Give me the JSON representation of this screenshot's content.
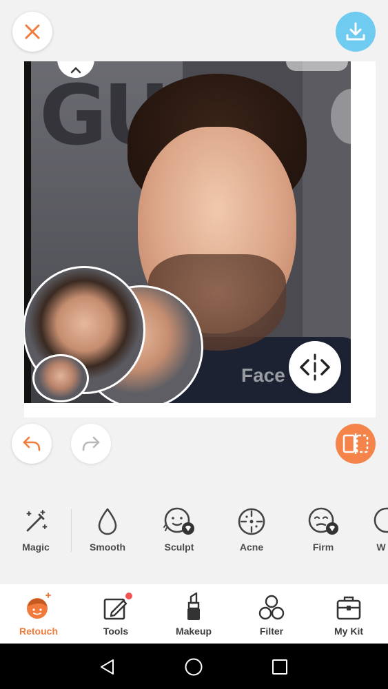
{
  "top_bar": {
    "close_icon": "close-icon",
    "download_icon": "download-icon"
  },
  "photo": {
    "watermark": "Face"
  },
  "history": {
    "undo_icon": "undo-icon",
    "redo_icon": "redo-icon",
    "compare_icon": "compare-icon"
  },
  "tools": [
    {
      "label": "Magic",
      "icon": "magic-wand-icon"
    },
    {
      "label": "Smooth",
      "icon": "drop-icon"
    },
    {
      "label": "Sculpt",
      "icon": "face-sculpt-icon",
      "premium": true
    },
    {
      "label": "Acne",
      "icon": "acne-icon"
    },
    {
      "label": "Firm",
      "icon": "face-firm-icon",
      "premium": true
    },
    {
      "label": "W",
      "icon": "partial-icon"
    }
  ],
  "bottom_nav": [
    {
      "label": "Retouch",
      "icon": "retouch-face-icon",
      "active": true
    },
    {
      "label": "Tools",
      "icon": "edit-icon",
      "notification": true
    },
    {
      "label": "Makeup",
      "icon": "lipstick-icon"
    },
    {
      "label": "Filter",
      "icon": "filter-circles-icon"
    },
    {
      "label": "My Kit",
      "icon": "kit-box-icon"
    }
  ],
  "colors": {
    "accent": "#f07b3c",
    "download_bg": "#6fcbf0",
    "compare_bg": "#f4844a",
    "close_x": "#f07b3c"
  }
}
